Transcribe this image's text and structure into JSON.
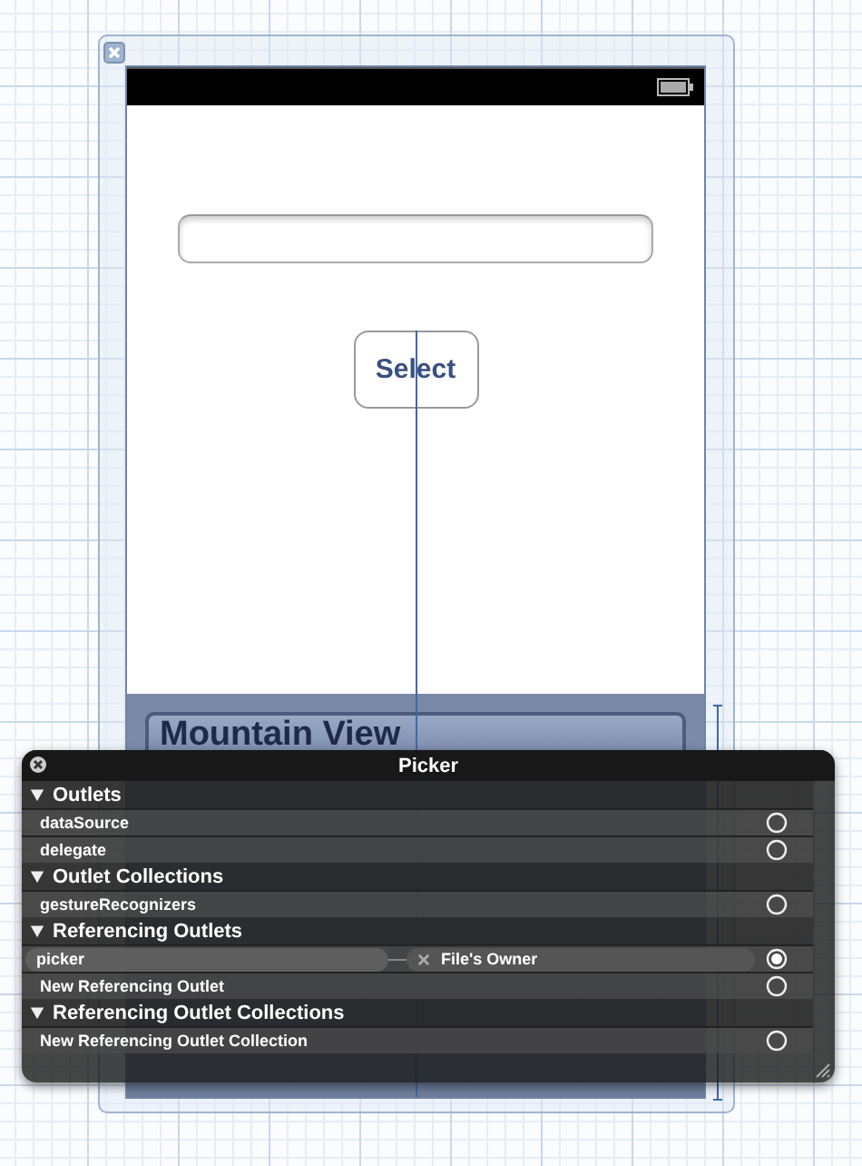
{
  "device_view": {
    "button": {
      "label": "Select"
    },
    "picker": {
      "rows": [
        {
          "label": "Mountain View",
          "selected": true
        }
      ]
    }
  },
  "connections_panel": {
    "title": "Picker",
    "sections": [
      {
        "title": "Outlets",
        "expanded": true,
        "items": [
          {
            "name": "dataSource",
            "connected": false
          },
          {
            "name": "delegate",
            "connected": false
          }
        ]
      },
      {
        "title": "Outlet Collections",
        "expanded": true,
        "items": [
          {
            "name": "gestureRecognizers",
            "connected": false
          }
        ]
      },
      {
        "title": "Referencing Outlets",
        "expanded": true,
        "items": [
          {
            "name": "picker",
            "connected": true,
            "target": "File's Owner"
          },
          {
            "name": "New Referencing Outlet",
            "connected": false
          }
        ]
      },
      {
        "title": "Referencing Outlet Collections",
        "expanded": true,
        "items": [
          {
            "name": "New Referencing Outlet Collection",
            "connected": false
          }
        ]
      }
    ]
  }
}
